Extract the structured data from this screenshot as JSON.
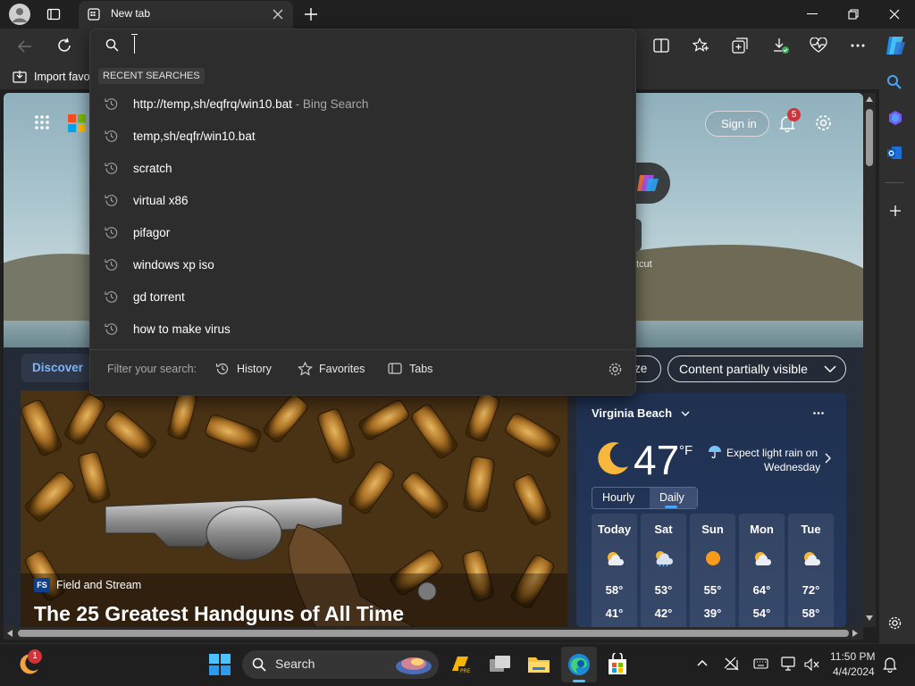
{
  "browser": {
    "tab_title": "New tab",
    "favorites_import_label": "Import favo"
  },
  "dropdown": {
    "recent_label": "RECENT SEARCHES",
    "items": [
      {
        "text": "http://temp,sh/eqfrq/win10.bat",
        "suffix": " - Bing Search"
      },
      {
        "text": "temp,sh/eqfr/win10.bat",
        "suffix": ""
      },
      {
        "text": "scratch",
        "suffix": ""
      },
      {
        "text": "virtual x86",
        "suffix": ""
      },
      {
        "text": "pifagor",
        "suffix": ""
      },
      {
        "text": "windows xp iso",
        "suffix": ""
      },
      {
        "text": "gd torrent",
        "suffix": ""
      },
      {
        "text": "how to make virus",
        "suffix": ""
      }
    ],
    "filter_label": "Filter your search:",
    "filter_history": "History",
    "filter_favorites": "Favorites",
    "filter_tabs": "Tabs"
  },
  "newtab": {
    "sign_in": "Sign in",
    "notification_count": "5",
    "discover_label": "Discover",
    "personalize_partial": "ze",
    "content_visibility": "Content partially visible",
    "shortcut_partial": "tcut",
    "article": {
      "source_badge": "FS",
      "source": "Field and Stream",
      "headline": "The 25 Greatest Handguns of All Time"
    },
    "weather": {
      "location": "Virginia Beach",
      "temp": "47",
      "unit": "°F",
      "forecast_line1": "Expect light rain on",
      "forecast_line2": "Wednesday",
      "tab_hourly": "Hourly",
      "tab_daily": "Daily",
      "days": [
        {
          "name": "Today",
          "high": "58°",
          "low": "41°",
          "icon": "partly-cloudy-icon"
        },
        {
          "name": "Sat",
          "high": "53°",
          "low": "42°",
          "icon": "cloudy-sun-icon"
        },
        {
          "name": "Sun",
          "high": "55°",
          "low": "39°",
          "icon": "sunny-icon"
        },
        {
          "name": "Mon",
          "high": "64°",
          "low": "54°",
          "icon": "partly-cloudy-icon"
        },
        {
          "name": "Tue",
          "high": "72°",
          "low": "58°",
          "icon": "partly-cloudy-icon"
        }
      ]
    }
  },
  "taskbar": {
    "search_label": "Search",
    "widget_badge": "1",
    "time": "11:50 PM",
    "date": "4/4/2024"
  },
  "colors": {
    "accent": "#0a6cd6",
    "notification": "#d13438",
    "weather_card": "#1f3050"
  }
}
